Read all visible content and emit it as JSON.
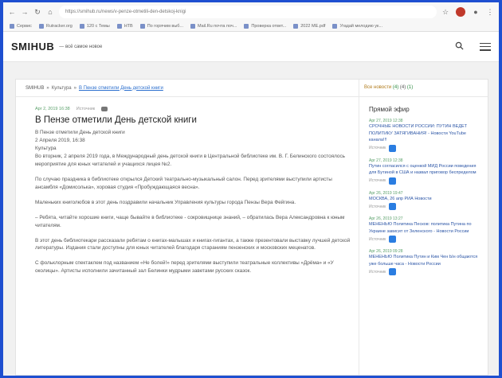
{
  "browser": {
    "url": "https://smihub.ru/news/v-penze-otmetili-den-detskoj-knigi",
    "bookmarks": [
      "Сервис",
      "Rutracker.org",
      "120 с Темы",
      "НТВ",
      "По горячим выб...",
      "Mail.Ru почта поч...",
      "Проверка ответ...",
      "2022 МЕ.pdf",
      "Угадай мелодию ук..."
    ]
  },
  "site": {
    "logo": "SMIHUB",
    "tagline": "— всё самое новое"
  },
  "breadcrumb": {
    "home": "SMIHUB",
    "sep1": "»",
    "category": "Культура",
    "sep2": "»",
    "current": "В Пензе отметили День детской книги"
  },
  "rating": {
    "label": "Все новости",
    "count_a": "(4)",
    "count_b": "(4)",
    "count_c": "(1)"
  },
  "article": {
    "date": "Apr 2, 2019 16:38",
    "source": "Источник",
    "title": "В Пензе отметили День детской книги",
    "subtitle": "В Пензе отметили День детской книги",
    "dateline": "2 Апреля 2019, 16:38",
    "category": "Культура",
    "paragraphs": [
      "Во вторник, 2 апреля 2019 года, в Международный день детской книги в Центральной библиотеке им. В. Г. Белинского состоялось мероприятие для юных читателей и учащихся лицея №2.",
      "По случаю праздника в библиотеке открылся Детский театрально-музыкальный салон. Перед зрителями выступили артисты ансамбля «Домисолька», хоровая студия «Пробуждающаяся весна».",
      "Маленьких книголюбов в этот день поздравили начальник Управления культуры города Пензы Вера Фейгина.",
      "– Ребята, читайте хорошие книги, чаще бывайте в библиотеке - сокровищнице знаний, – обратилась Вера Александровна к юным читателям.",
      "В этот день библиотекари рассказали ребятам о книгах-малышах и книгах-гигантах, а также презентовали выставку лучшей детской литературы. Издания стали доступны для юных читателей благодаря стараниям пензенских и московских меценатов.",
      "С фольклорным спектаклем под названием «Не болей!» перед зрителями выступили театральные коллективы «Дрёма» и «У околицы». Артисты исполнили зачитанный зал Белинки мудрыми заветами русских сказок."
    ]
  },
  "sidebar": {
    "title": "Прямой эфир",
    "items": [
      {
        "date": "Apr 27, 2019 12:38",
        "text": "СРОЧНЫЕ НОВОСТИ РОССИИ: ПУТИН ВЕДЕТ ПОЛИТИКУ ЗАТЯГИВАНИЯ! - Новости YouTube канала!!!",
        "source": "Источник"
      },
      {
        "date": "Apr 27, 2019 12:38",
        "text": "Путин согласился с оценкой МИД России поведения для Бутиной в США и назвал приговор беспределом",
        "source": "Источник"
      },
      {
        "date": "Apr 26, 2019 19:47",
        "text": "МОСКВА, 26 апр РИА Новости",
        "source": "Источник"
      },
      {
        "date": "Apr 26, 2019 13:27",
        "text": "МЕНЕНЬЮ Политика Песков: политика Путина по Украине зависит от Зеленского - Новости России",
        "source": "Источник"
      },
      {
        "date": "Apr 26, 2019 09:28",
        "text": "МЕНЕНЬЮ Политика Путин и Ким Чен Ын общаются уже больше часа - Новости России",
        "source": "Источник"
      }
    ]
  }
}
